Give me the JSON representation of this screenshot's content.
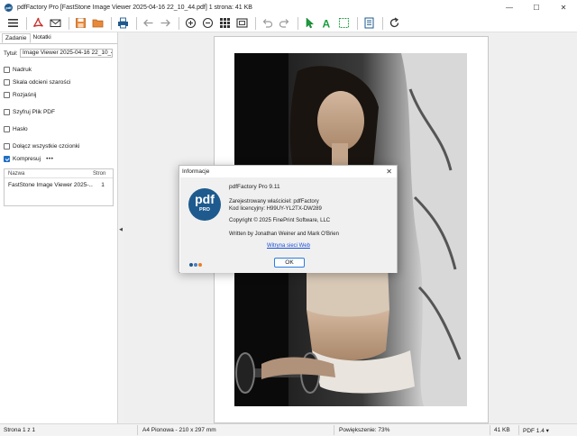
{
  "window": {
    "title": "pdfFactory Pro [FastStone Image Viewer 2025-04-16 22_10_44.pdf] 1 strona: 41 KB",
    "icon": "pdf-app-icon",
    "controls": {
      "minimize": "—",
      "maximize": "☐",
      "close": "✕"
    }
  },
  "toolbar": {
    "icons": [
      "menu-icon",
      "pdf-icon",
      "email-icon",
      "save-icon",
      "open-folder-icon",
      "print-icon",
      "back-arrow-icon",
      "forward-arrow-icon",
      "zoom-in-icon",
      "zoom-out-icon",
      "thumbnails-icon",
      "fit-page-icon",
      "undo-icon",
      "redo-icon",
      "pointer-icon",
      "text-tool-icon",
      "select-area-icon",
      "document-info-icon",
      "refresh-icon"
    ],
    "accent": "#c5322d"
  },
  "left_panel": {
    "tabs": [
      "Zadanie",
      "Notatki"
    ],
    "title_label": "Tytuł:",
    "title_value": "Image Viewer 2025-04-16 22_10_44",
    "options": [
      {
        "label": "Nadruk",
        "checked": false
      },
      {
        "label": "Skala odcieni szarości",
        "checked": false
      },
      {
        "label": "Rozjaśnij",
        "checked": false
      },
      {
        "label": "Szyfruj Plik PDF",
        "checked": false
      },
      {
        "label": "Hasło",
        "checked": false
      },
      {
        "label": "Dołącz wszystkie czcionki",
        "checked": false
      },
      {
        "label": "Kompresuj",
        "checked": true
      }
    ],
    "more": "•••",
    "table": {
      "headers": [
        "Nazwa",
        "Stron"
      ],
      "rows": [
        {
          "name": "FastStone Image Viewer 2025-...",
          "pages": "1"
        }
      ]
    }
  },
  "splitter": {
    "grip": "◀"
  },
  "dialog": {
    "title": "Informacje",
    "close": "✕",
    "logo_text": "pdf",
    "logo_sub": "PRO",
    "product": "pdfFactory Pro 9.11",
    "registered": "Zarejestrowany właściciel:  pdfFactory",
    "license": "Kod licencyjny:  H99UY-YL2TX-DW289",
    "copyright": "Copyright © 2025 FinePrint Software, LLC",
    "authors": "Written by Jonathan Weiner and Mark O'Brien",
    "link": "Witryna sieci Web",
    "ok": "OK",
    "dot_colors": [
      "#1e5a8e",
      "#4a7fc0",
      "#e67e22"
    ]
  },
  "status": {
    "page": "Strona 1 z 1",
    "paper": "A4 Pionowa - 210 x 297 mm",
    "zoom": "Powiększenie: 73%",
    "size": "41 KB",
    "pdf_version": "PDF 1.4 ▾"
  }
}
